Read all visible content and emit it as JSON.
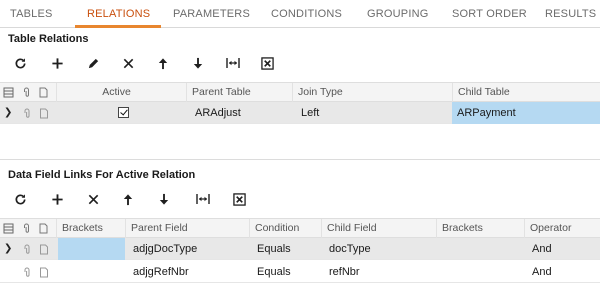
{
  "tabs": [
    {
      "label": "TABLES"
    },
    {
      "label": "RELATIONS",
      "active": true
    },
    {
      "label": "PARAMETERS"
    },
    {
      "label": "CONDITIONS"
    },
    {
      "label": "GROUPING"
    },
    {
      "label": "SORT ORDER"
    },
    {
      "label": "RESULTS"
    }
  ],
  "accent_color": "#e8862f",
  "relations": {
    "title": "Table Relations",
    "toolbar": [
      "refresh-icon",
      "add-icon",
      "edit-icon",
      "delete-icon",
      "arrow-up-icon",
      "arrow-down-icon",
      "fit-width-icon",
      "export-excel-icon"
    ],
    "columns": {
      "active": "Active",
      "parent_table": "Parent Table",
      "join_type": "Join Type",
      "child_table": "Child Table"
    },
    "rows": [
      {
        "active": true,
        "parent_table": "ARAdjust",
        "join_type": "Left",
        "child_table": "ARPayment",
        "selected": true
      }
    ]
  },
  "links": {
    "title": "Data Field Links For Active Relation",
    "toolbar": [
      "refresh-icon",
      "add-icon",
      "delete-icon",
      "arrow-up-icon",
      "arrow-down-icon",
      "fit-width-icon",
      "export-excel-icon"
    ],
    "columns": {
      "brackets_open": "Brackets",
      "parent_field": "Parent Field",
      "condition": "Condition",
      "child_field": "Child Field",
      "brackets_close": "Brackets",
      "operator": "Operator"
    },
    "rows": [
      {
        "brackets_open": "",
        "parent_field": "adjgDocType",
        "condition": "Equals",
        "child_field": "docType",
        "brackets_close": "",
        "operator": "And",
        "selected": true
      },
      {
        "brackets_open": "",
        "parent_field": "adjgRefNbr",
        "condition": "Equals",
        "child_field": "refNbr",
        "brackets_close": "",
        "operator": "And"
      }
    ]
  }
}
